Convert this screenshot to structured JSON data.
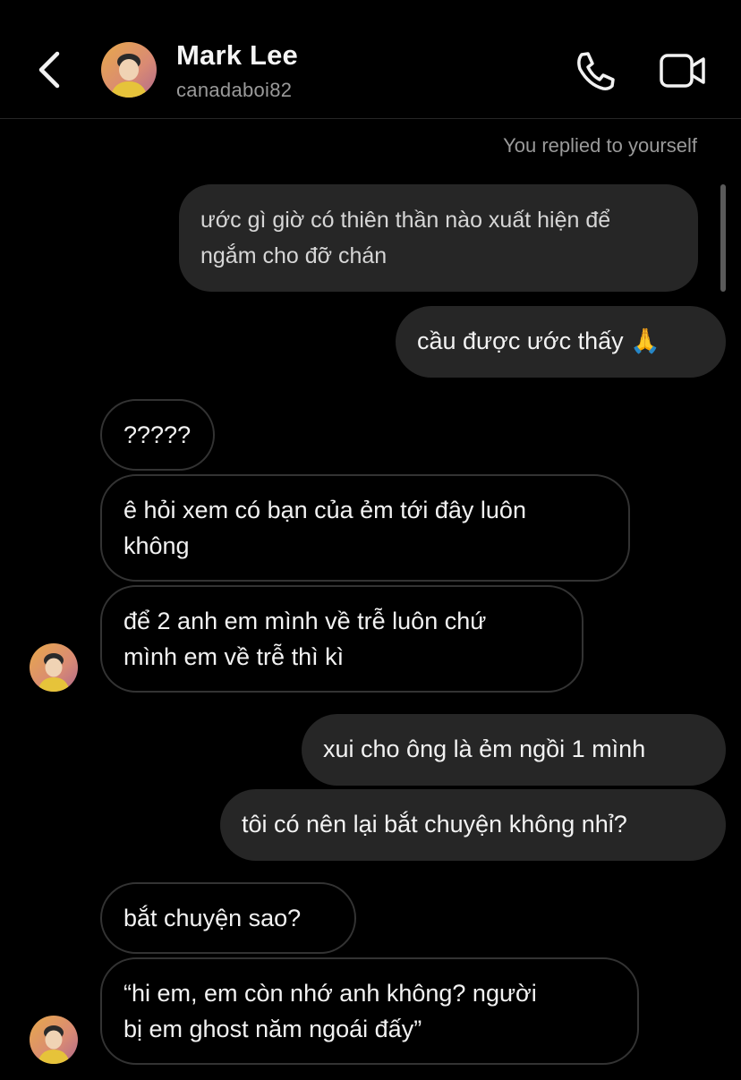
{
  "header": {
    "back_icon": "chevron-left-icon",
    "name": "Mark Lee",
    "handle": "canadaboi82",
    "call_icon": "phone-icon",
    "video_icon": "video-camera-icon"
  },
  "thread": {
    "reply_note": "You replied to yourself",
    "quoted_message": "ước gì giờ có thiên thần nào xuất hiện để\nngắm cho đỡ chán",
    "messages": [
      {
        "sender": "me",
        "text": "cầu được ước thấy 🙏"
      },
      {
        "sender": "them",
        "text": "?????"
      },
      {
        "sender": "them",
        "text": "ê hỏi xem có bạn của ẻm tới đây luôn\nkhông"
      },
      {
        "sender": "them",
        "text": "để 2 anh em mình về trễ luôn chứ\nmình em về trễ thì kì"
      },
      {
        "sender": "me",
        "text": "xui cho ông là ẻm ngồi 1 mình"
      },
      {
        "sender": "me",
        "text": "tôi có nên lại bắt chuyện không nhỉ?"
      },
      {
        "sender": "them",
        "text": "bắt chuyện sao?"
      },
      {
        "sender": "them",
        "text": "“hi em, em còn nhớ anh không? người\nbị em ghost năm ngoái đấy”"
      }
    ]
  },
  "colors": {
    "background": "#000000",
    "my_bubble": "#262626",
    "their_bubble_border": "#333333",
    "secondary_text": "#9a9a9a"
  }
}
